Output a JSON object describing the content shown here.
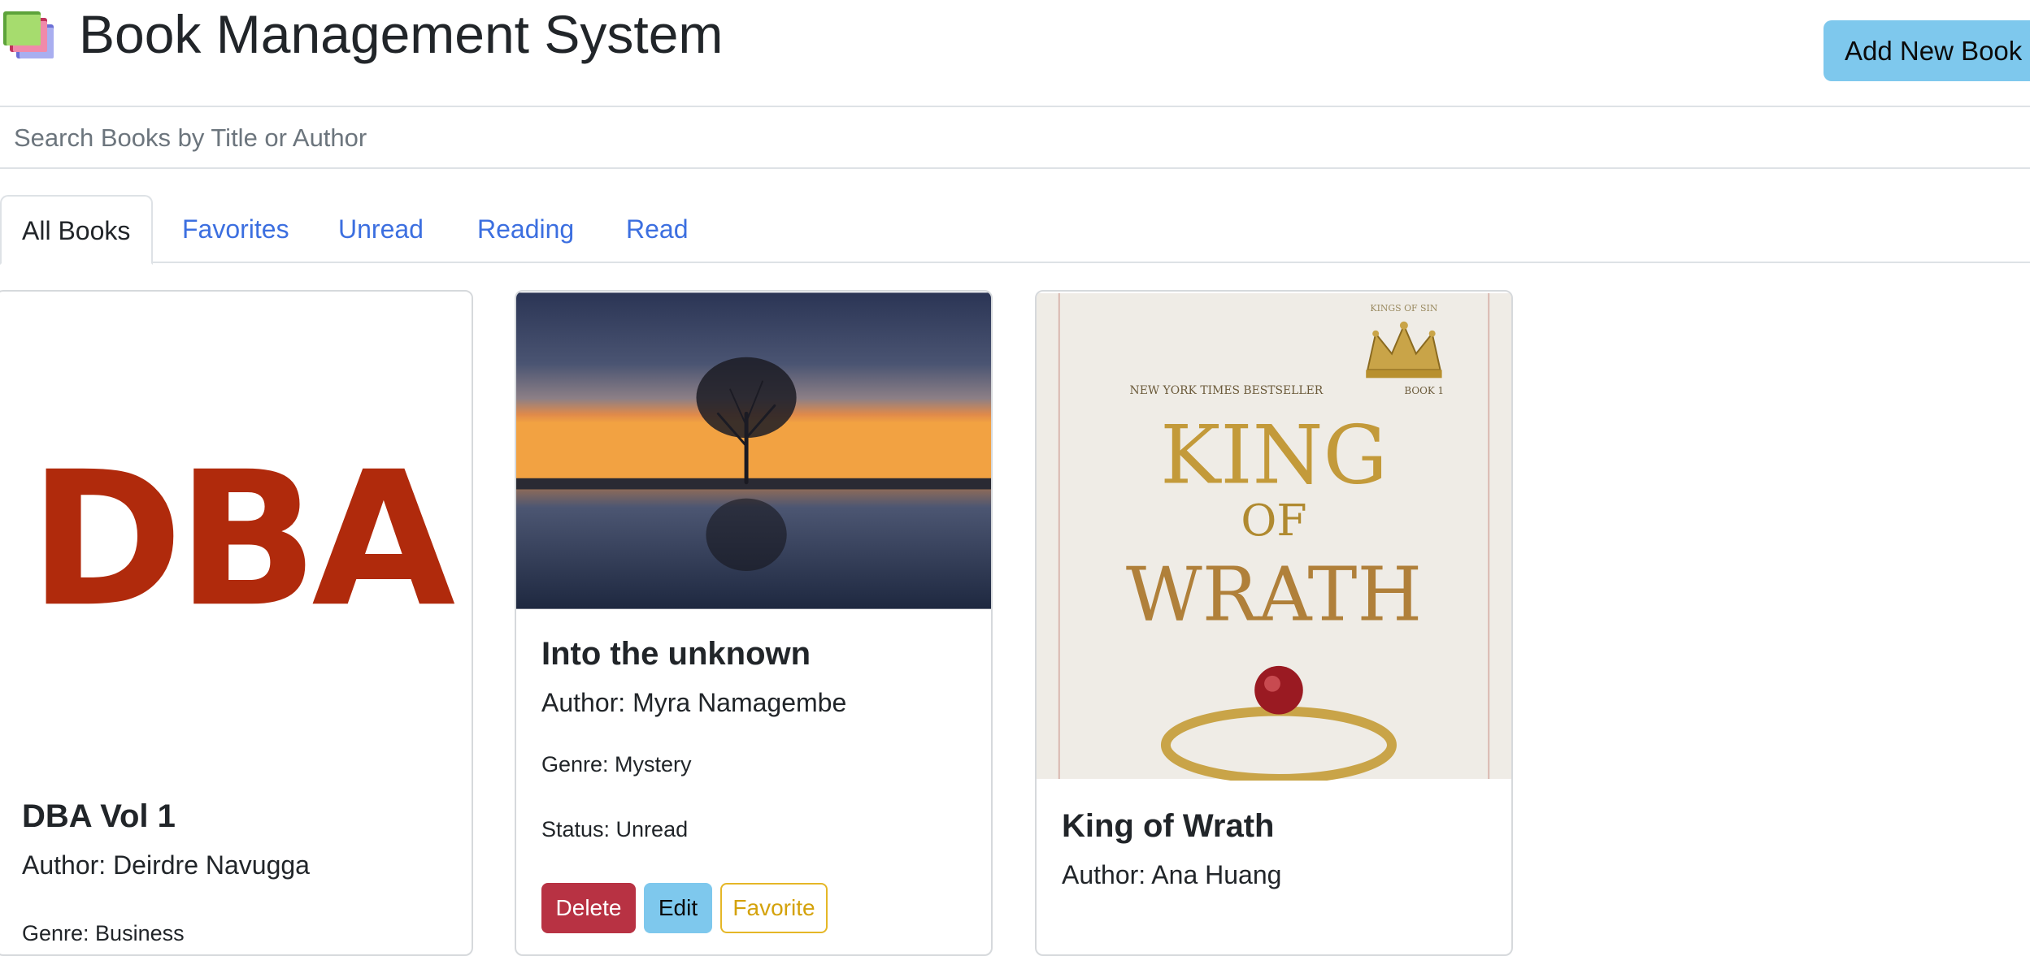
{
  "header": {
    "title": "Book Management System",
    "add_button_label": "Add New Book",
    "logo_icon": "books-icon"
  },
  "search": {
    "placeholder": "Search Books by Title or Author",
    "value": ""
  },
  "tabs": [
    {
      "label": "All Books",
      "active": true
    },
    {
      "label": "Favorites",
      "active": false
    },
    {
      "label": "Unread",
      "active": false
    },
    {
      "label": "Reading",
      "active": false
    },
    {
      "label": "Read",
      "active": false
    }
  ],
  "books": [
    {
      "title": "DBA Vol 1",
      "author": "Author: Deirdre Navugga",
      "cover_text": "DBA",
      "genre": "Genre: Business"
    },
    {
      "title": "Into the unknown",
      "author": "Author: Myra Namagembe",
      "genre": "Genre: Mystery",
      "status": "Status: Unread",
      "actions": {
        "delete": "Delete",
        "edit": "Edit",
        "favorite": "Favorite"
      }
    },
    {
      "title": "King of Wrath",
      "author": "Author: Ana Huang",
      "cover": {
        "line1": "KING",
        "line2": "OF",
        "line3": "WRATH",
        "tagline": "NEW YORK TIMES BESTSELLER",
        "book_no": "BOOK 1",
        "series": "KINGS OF SIN"
      }
    }
  ],
  "colors": {
    "accent": "#7ec8ed",
    "link": "#3c6fe0",
    "danger": "#b83243",
    "warning": "#e5b727",
    "dba_red": "#b02a0c"
  }
}
